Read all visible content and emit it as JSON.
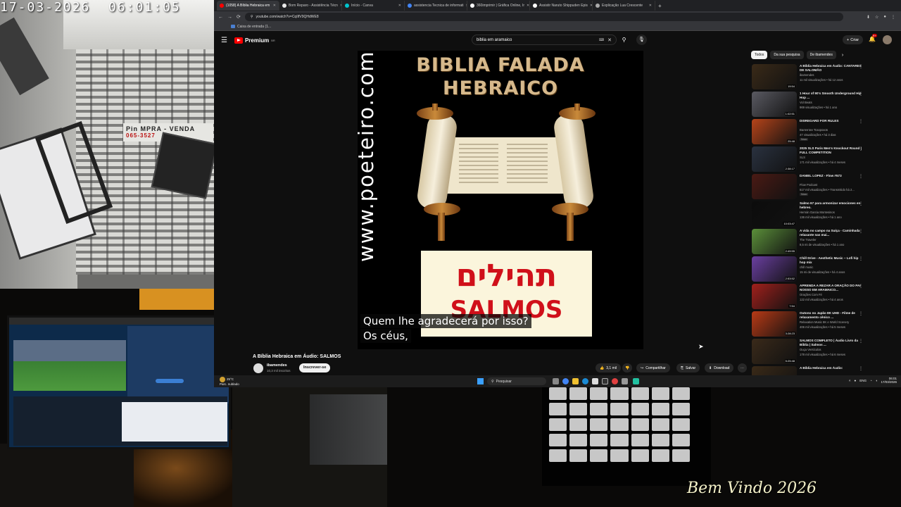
{
  "camera": {
    "timestamp": "17-03-2026  06:01:05",
    "sign_text": "Pin  MPRA - VENDA",
    "sign_phone": "065-3527"
  },
  "browser": {
    "tabs": [
      {
        "label": "(1058) A Bíblia Hebraica em",
        "favicon_color": "#ff0000",
        "active": true
      },
      {
        "label": "Bom Reparo - Assistência Técn",
        "favicon_color": "#e8e8e8",
        "active": false
      },
      {
        "label": "Início - Canva",
        "favicon_color": "#00c4cc",
        "active": false
      },
      {
        "label": "assistencia Tecnica de informati",
        "favicon_color": "#4285f4",
        "active": false
      },
      {
        "label": "360imprimir | Gráfica Online, Ir",
        "favicon_color": "#ffffff",
        "active": false
      },
      {
        "label": "Assistir Naruto Shippuden Epis",
        "favicon_color": "#ffffff",
        "active": false
      },
      {
        "label": "Explicação Lua Crescente",
        "favicon_color": "#aaaaaa",
        "active": false
      }
    ],
    "new_tab_label": "+",
    "url": "youtube.com/watch?v=CqIIfV9QHdWE8",
    "bookmark": "Caixa de entrada (1..."
  },
  "youtube": {
    "logo_text": "Premium",
    "logo_sup": "BR",
    "search_query": "biblia em aramaico",
    "create_label": "Criar",
    "notif_count": "9+",
    "video": {
      "title_line1": "BIBLIA FALADA",
      "title_line2": "HEBRAICO",
      "watermark": "www.poeteiro.com",
      "hebrew": "תהילים",
      "salmos": "SALMOS",
      "subtitle_1": "Quem lhe agradecerá por isso?",
      "subtitle_2": "Os céus,"
    },
    "info": {
      "title": "A Bíblia Hebraica em Áudio: SALMOS",
      "channel": "ibamendes",
      "subscribers": "10,3 mil inscritos",
      "subscribe_label": "Inscrever-se",
      "likes": "3,1 mil",
      "share": "Compartilhar",
      "save": "Salvar",
      "download": "Download"
    },
    "chips": [
      "Todos",
      "Da sua pesquisa",
      "De ibamendes"
    ],
    "recommendations": [
      {
        "title": "A Bíblia Hebraica em Áudio: CANTARES DE SALOMÃO",
        "channel": "ibamendes",
        "meta": "11 mil visualizações • há 12 anos",
        "duration": "19:54",
        "color": "#3a2a18",
        "badge": ""
      },
      {
        "title": "1 Hour of 90's Smooth Underground Hip Hop ...",
        "channel": "Vol Beats",
        "meta": "969 visualizações • há 1 ano",
        "duration": "1:02:51",
        "color": "#5a5a62",
        "badge": ""
      },
      {
        "title": "DISREGARD FOR RULES",
        "channel": "Валентин Тозорохов",
        "meta": "47 visualizações • há 3 dias",
        "duration": "25:48",
        "color": "#b6441a",
        "badge": "Novo"
      },
      {
        "title": "2025 SLS Paris Men's Knockout Round | FULL COMPETITION",
        "channel": "SLS",
        "meta": "171 mil visualizações • há 4 meses",
        "duration": "2:38:17",
        "color": "#2a3240",
        "badge": ""
      },
      {
        "title": "DANIEL LOPEZ - Flow #573",
        "channel": "Flow Podcast",
        "meta": "517 mil visualizações • Transmitido há 2...",
        "duration": "",
        "color": "#4a1a14",
        "badge": "Novo"
      },
      {
        "title": "Salmo 67 para armonizar emociones en hebreo.",
        "channel": "Hernán Garcia Montesinos",
        "meta": "136 mil visualizações • há 1 ano",
        "duration": "10:03:47",
        "color": "#0c0c0c",
        "badge": ""
      },
      {
        "title": "A vida no campo na Suíça - Caminhada relaxante nas mai...",
        "channel": "The Traveler",
        "meta": "8,5 mi de visualizações • há 1 ano",
        "duration": "2:49:55",
        "color": "#5b8f3a",
        "badge": ""
      },
      {
        "title": "Chill Drive - Aesthetic Music ~ Lofi hip hop mix",
        "channel": "chill music",
        "meta": "15 mi de visualizações • há 4 anos",
        "duration": "2:53:52",
        "color": "#6a3fa0",
        "badge": ""
      },
      {
        "title": "APRENDA A REZAR A ORAÇÃO DO PAI NOSSO EM ARAMAICO...",
        "channel": "Orações Com Fé",
        "meta": "122 mil visualizações • há 4 anos",
        "duration": "7:54",
        "color": "#a0201c",
        "badge": ""
      },
      {
        "title": "Outono no Japão 8K UHD - Filme de relaxamento cênico ...",
        "channel": "Relaxation Music 8K e World Scenery",
        "meta": "406 mil visualizações • há 5 meses",
        "duration": "3:28:23",
        "color": "#b83a16",
        "badge": ""
      },
      {
        "title": "SALMOS COMPLETO | Áudio Livro da Bíblia | Salmos ...",
        "channel": "Ouça Versículos",
        "meta": "178 mil visualizações • há 6 meses",
        "duration": "5:25:48",
        "color": "#3a2a1a",
        "badge": ""
      },
      {
        "title": "A Bíblia Hebraica em Áudio:",
        "channel": "",
        "meta": "",
        "duration": "",
        "color": "#3a2a18",
        "badge": ""
      }
    ]
  },
  "taskbar": {
    "temperature": "25°C",
    "weather": "Parc. nublado",
    "search_label": "Pesquisar",
    "lang": "ENG",
    "time": "06:01",
    "date": "17/03/2026"
  },
  "overlay": {
    "welcome": "Bem Vindo 2026"
  }
}
